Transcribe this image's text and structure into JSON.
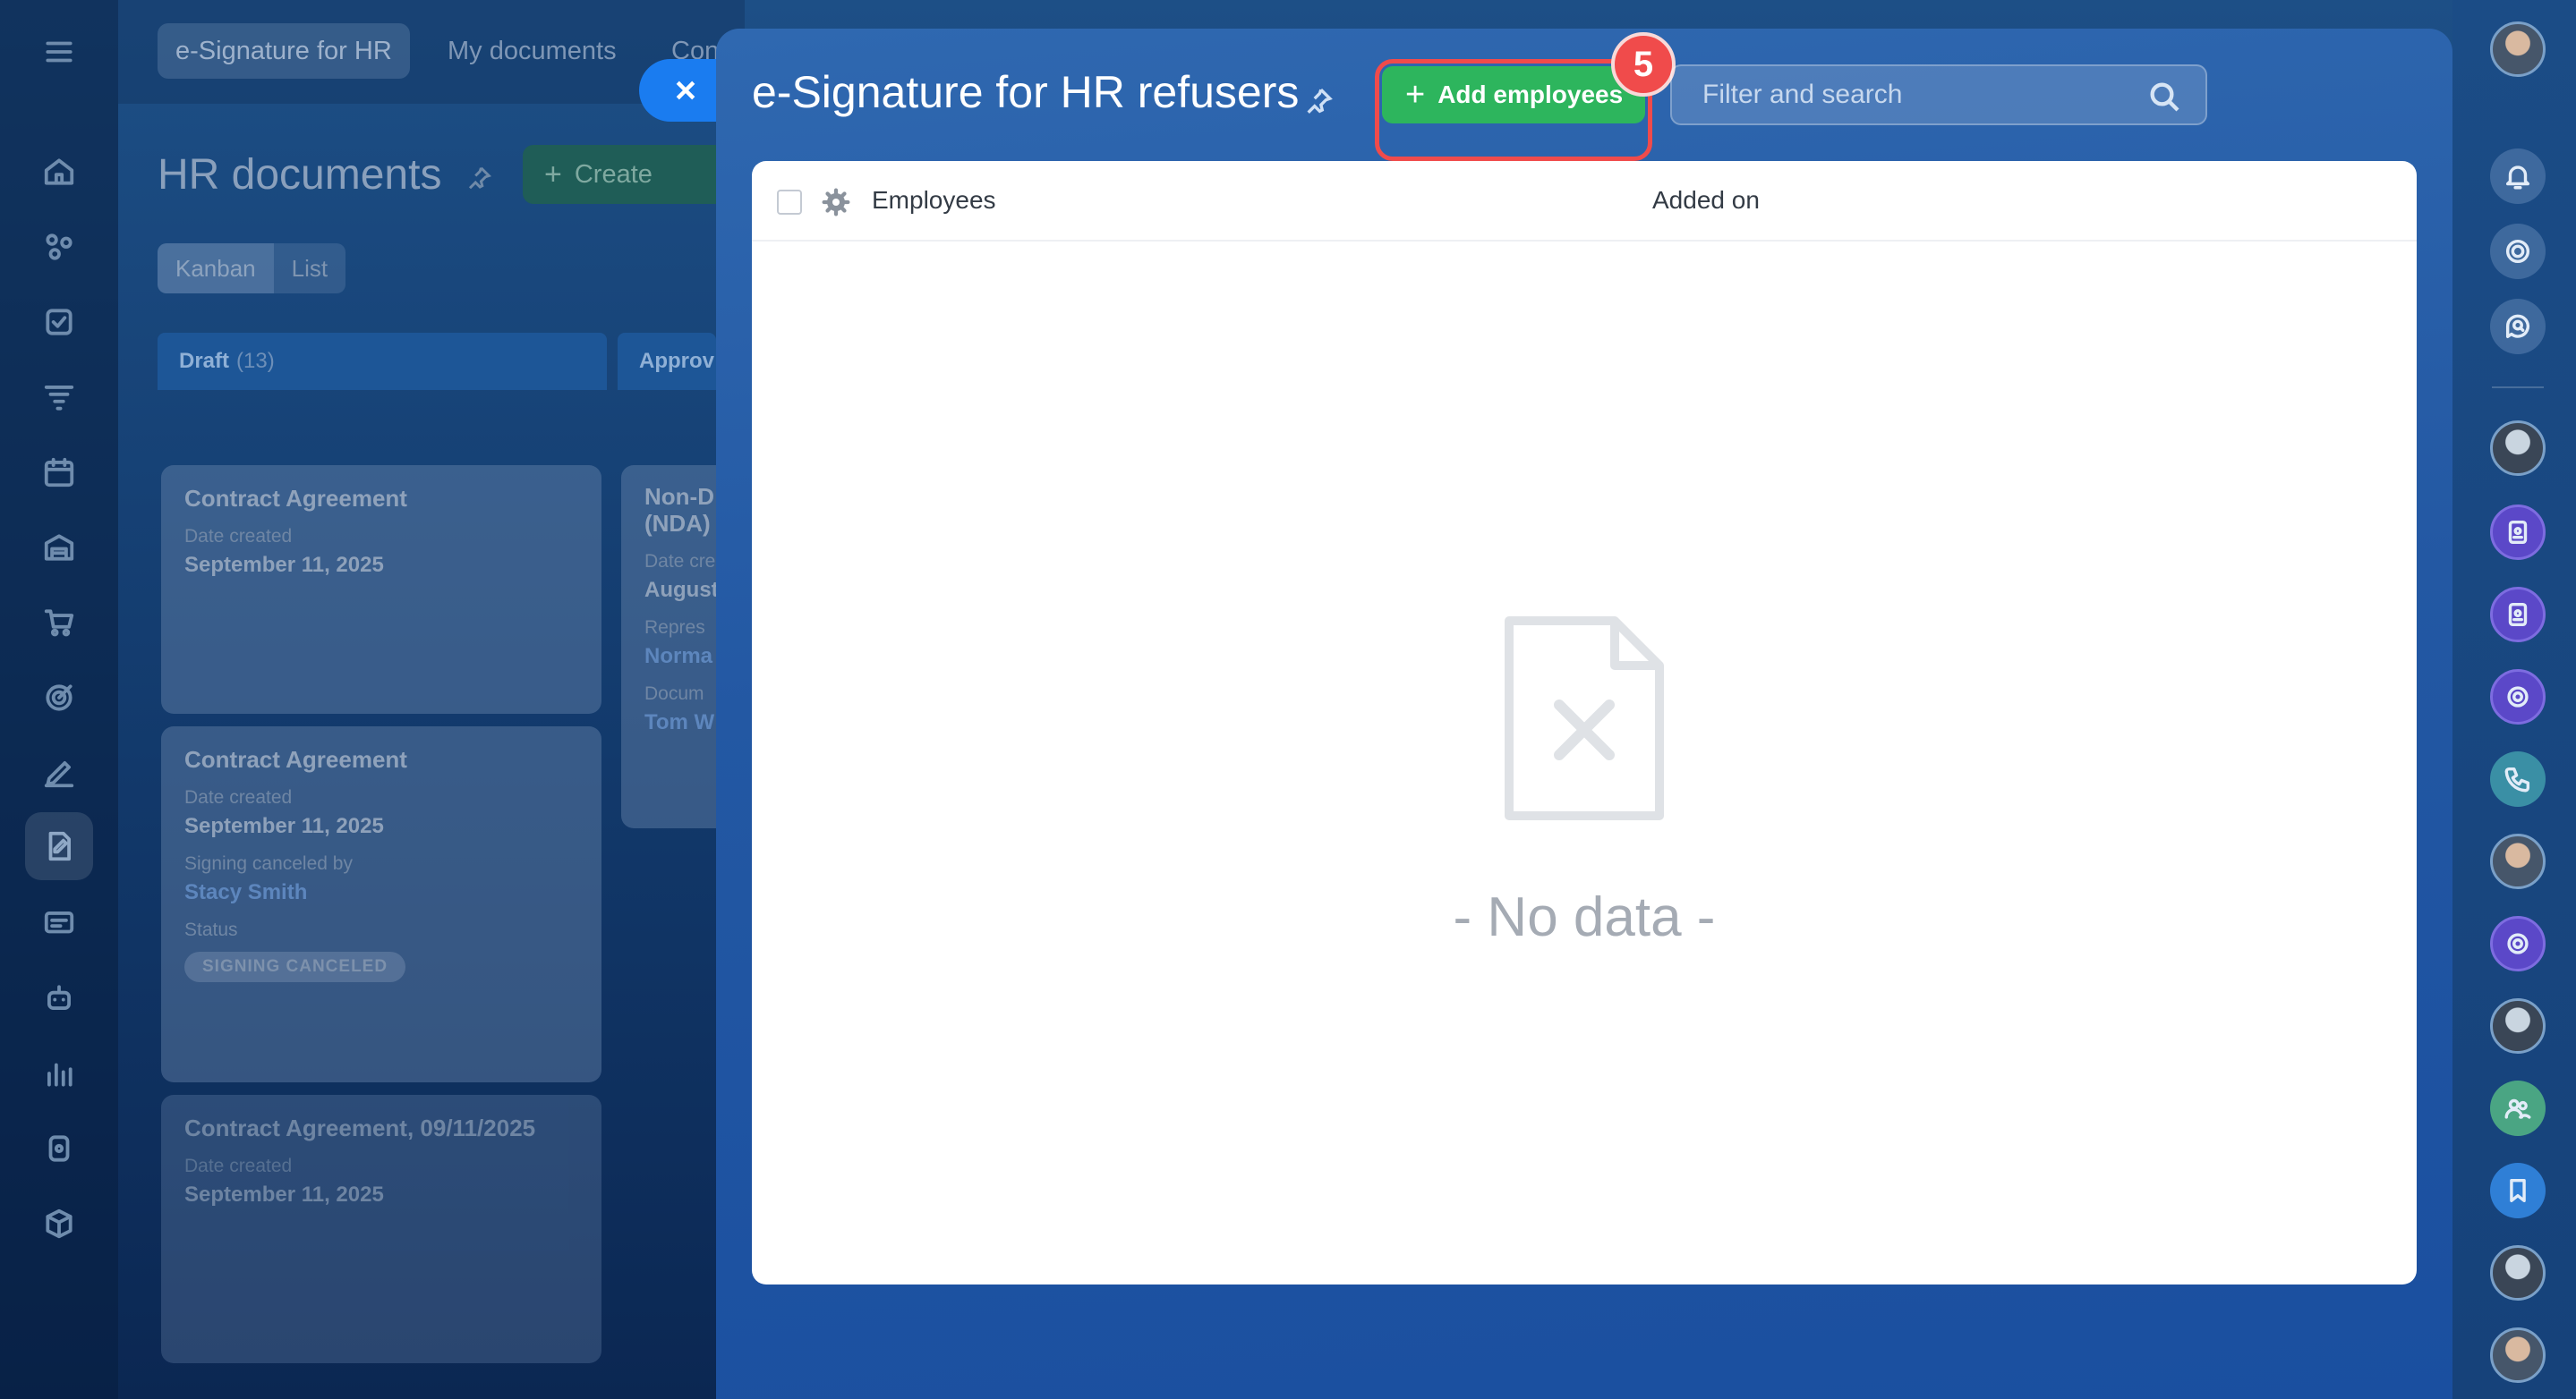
{
  "background_app": {
    "tabs": [
      "e-Signature for HR",
      "My documents",
      "Con"
    ],
    "page_title": "HR documents",
    "create_label": "Create",
    "views": [
      "Kanban",
      "List"
    ],
    "columns": [
      {
        "title": "Draft",
        "count": "(13)"
      },
      {
        "title": "Approv",
        "count": ""
      }
    ],
    "cards": {
      "c1": {
        "title": "Contract Agreement",
        "date_label": "Date created",
        "date": "September 11, 2025"
      },
      "c2": {
        "title": "Contract Agreement",
        "date_label": "Date created",
        "date": "September 11, 2025",
        "canceled_label": "Signing canceled by",
        "canceled_by": "Stacy Smith",
        "status_label": "Status",
        "status": "SIGNING CANCELED"
      },
      "c3": {
        "title": "Contract Agreement, 09/11/2025",
        "date_label": "Date created",
        "date": "September 11, 2025"
      },
      "c4": {
        "title": "Non-D (NDA)",
        "date_label": "Date cre",
        "date": "August",
        "rep_label": "Repres",
        "rep": "Norma",
        "doc_label": "Docum",
        "doc": "Tom W"
      }
    }
  },
  "panel": {
    "title": "e-Signature for HR refusers",
    "add_button": "Add employees",
    "step_number": "5",
    "search_placeholder": "Filter and search",
    "columns": [
      "Employees",
      "Added on"
    ],
    "empty_text": "- No data -"
  },
  "colors": {
    "accent_green": "#2db55d",
    "highlight_red": "#f04b4b",
    "close_blue": "#1a7cf0"
  }
}
